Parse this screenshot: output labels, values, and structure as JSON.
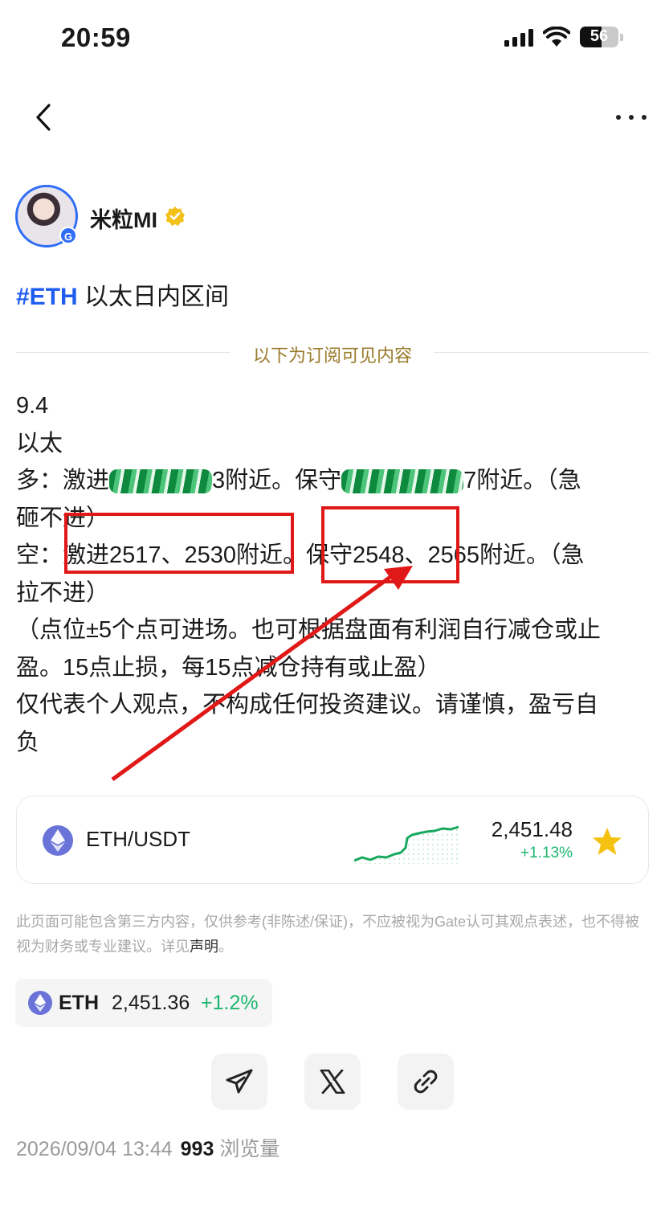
{
  "status_bar": {
    "time": "20:59",
    "battery": "56"
  },
  "nav": {
    "back_icon": "chevron-left-icon",
    "more_icon": "more-horizontal-icon"
  },
  "author": {
    "name": "米粒MI",
    "avatar_badge": "G"
  },
  "post": {
    "tag": "#ETH",
    "title": " 以太日内区间",
    "subscriber_divider": "以下为订阅可见内容",
    "date_line": "9.4",
    "coin_line": "以太",
    "long_prefix": "多：激进",
    "long_mid_visible": "3附近。保守",
    "long_tail": "7附近。（急",
    "long_cont": "砸不进）",
    "short_line": "空：激进2517、2530附近。保守2548、2565附近。（急",
    "short_cont": "拉不进）",
    "note_1": "（点位±5个点可进场。也可根据盘面有利润自行减仓或止",
    "note_2": "盈。15点止损，每15点减仓持有或止盈）",
    "disclaim_1": "仅代表个人观点，不构成任何投资建议。请谨慎，盈亏自",
    "disclaim_2": "负"
  },
  "market_card": {
    "pair": "ETH/USDT",
    "price": "2,451.48",
    "change": "+1.13%",
    "change_color": "#1db56e",
    "favorite_icon": "star-icon"
  },
  "disclaimer": {
    "text": "此页面可能包含第三方内容，仅供参考(非陈述/保证)，不应被视为Gate认可其观点表述，也不得被视为财务或专业建议。详见",
    "link": "声明",
    "end": "。"
  },
  "ticker": {
    "symbol": "ETH",
    "price": "2,451.36",
    "change": "+1.2%"
  },
  "share": {
    "telegram_icon": "send-icon",
    "x_icon": "x-logo-icon",
    "link_icon": "link-icon"
  },
  "meta": {
    "datetime": "2026/09/04 13:44",
    "views": "993",
    "views_label": "浏览量"
  },
  "colors": {
    "accent": "#1f5cf0",
    "positive": "#1db56e",
    "annotation": "#e01818",
    "divider_text": "#9a7a2a"
  }
}
